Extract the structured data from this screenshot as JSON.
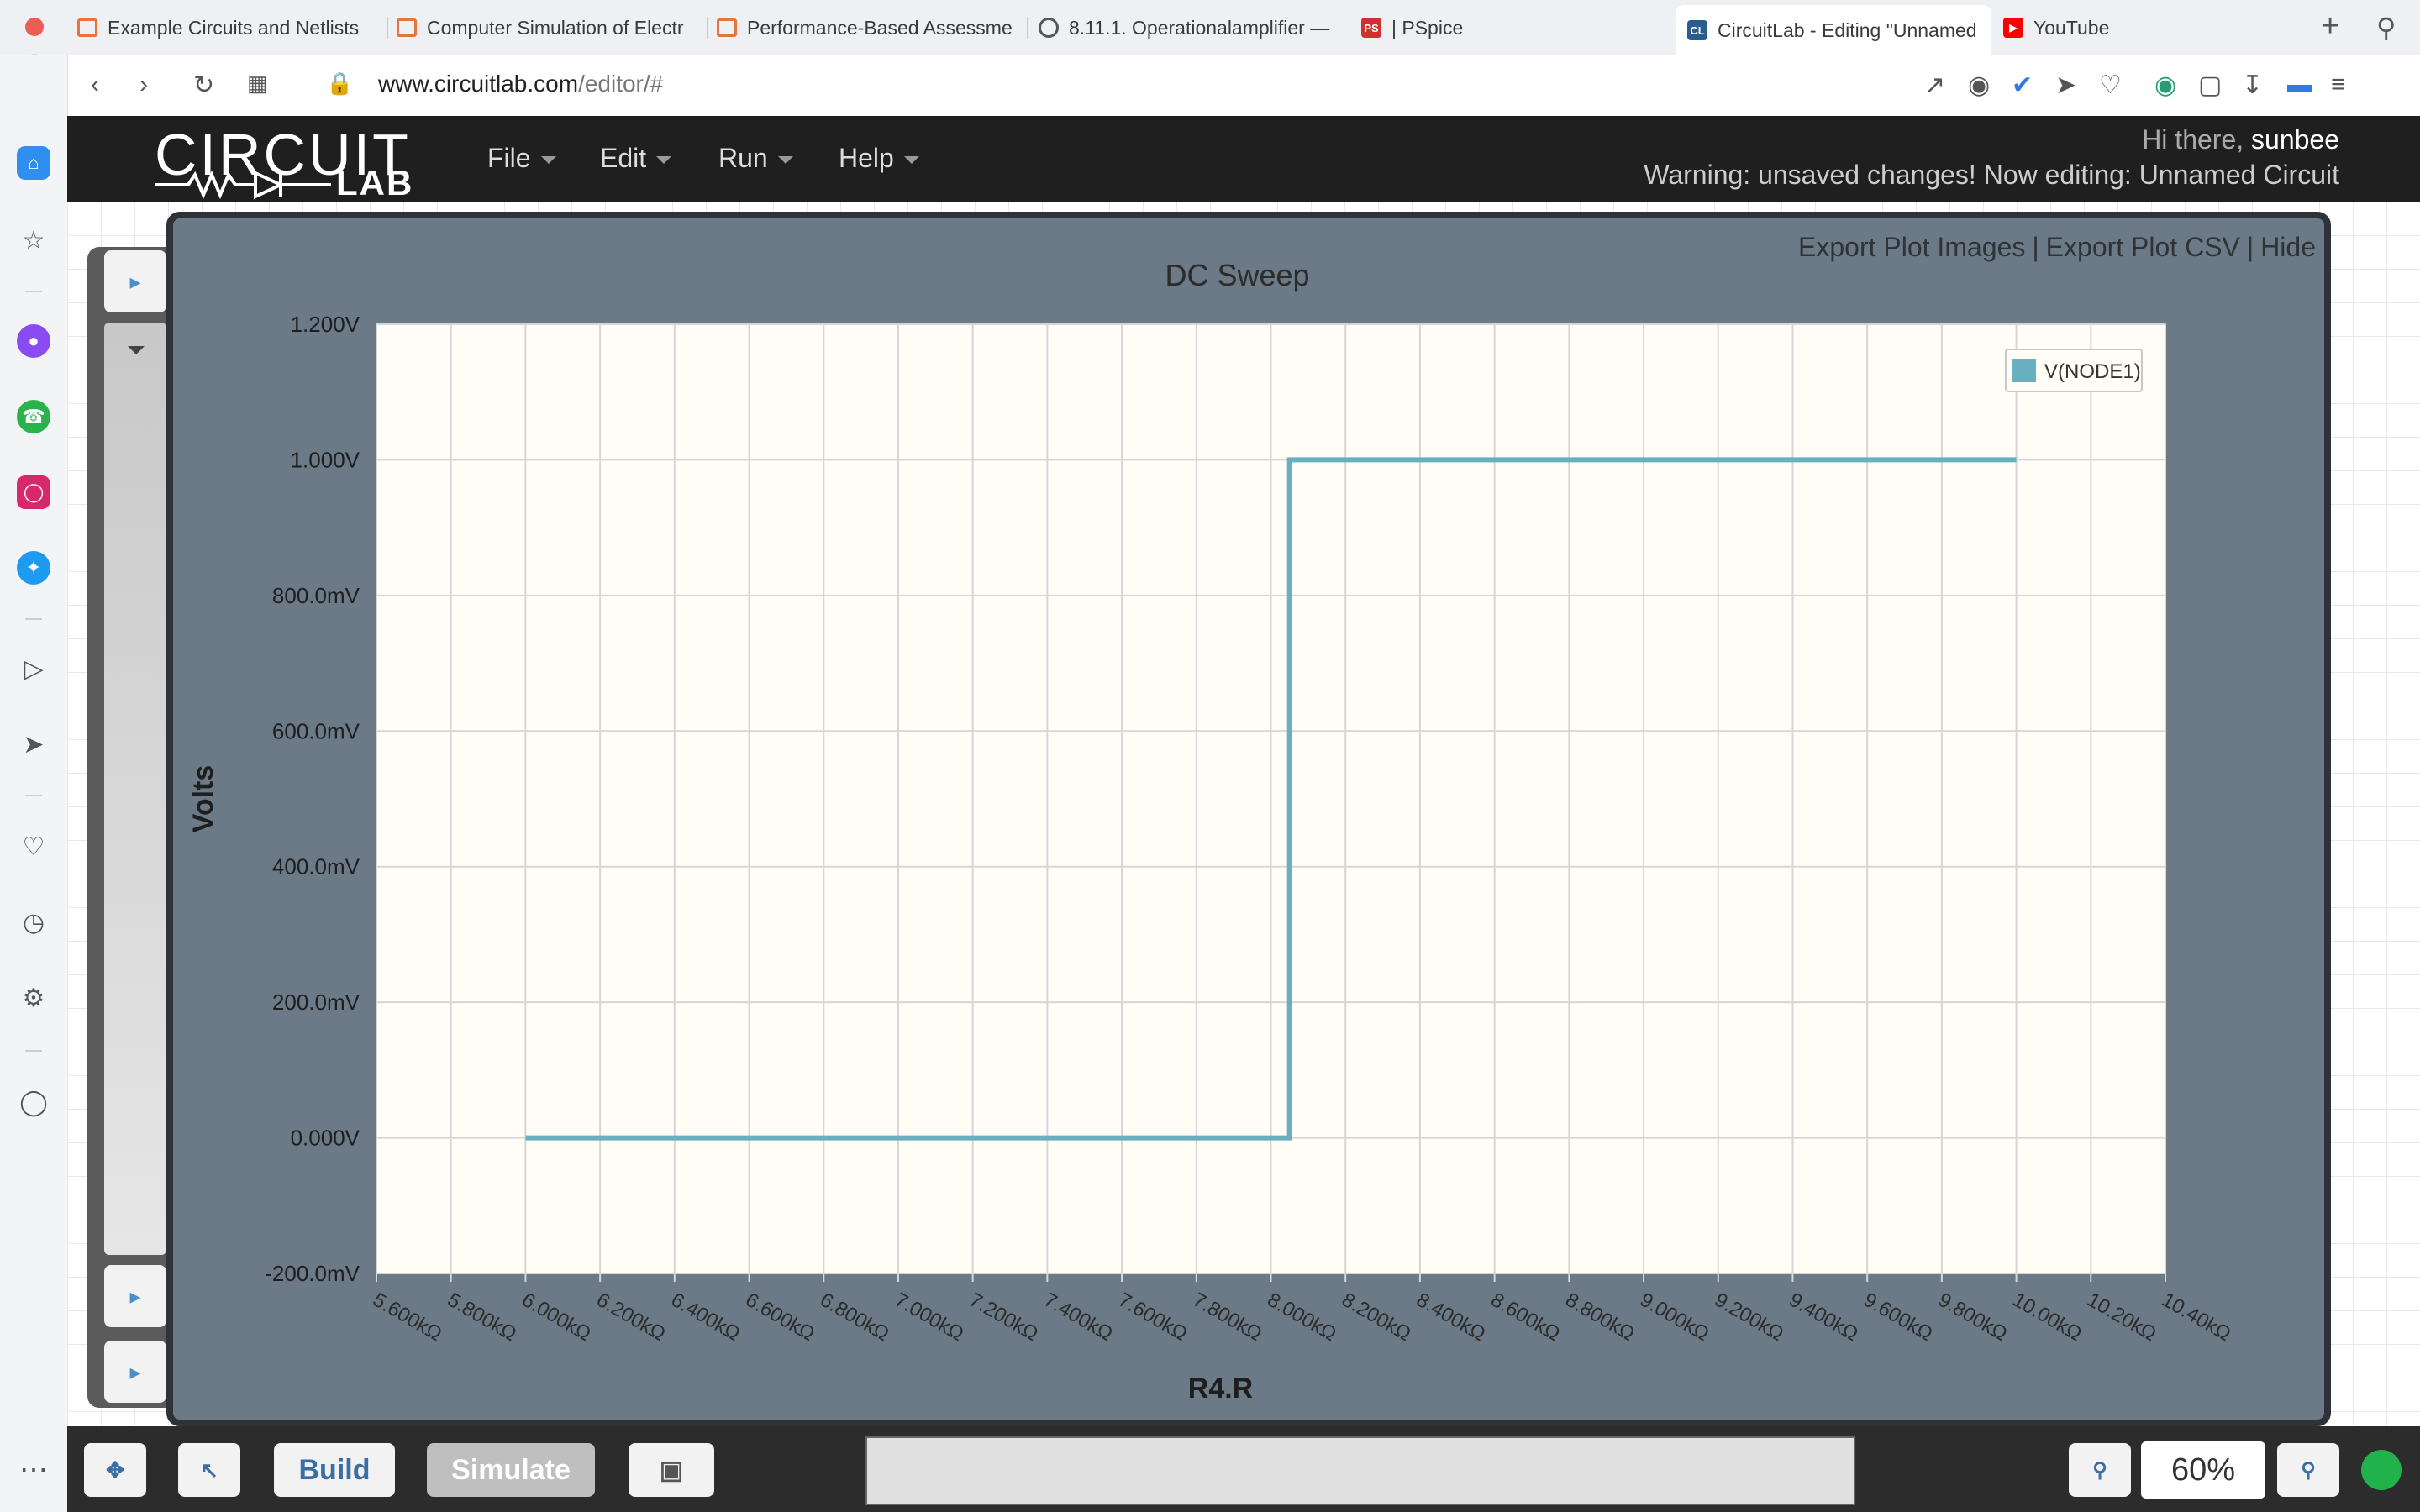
{
  "browser": {
    "tabs": [
      {
        "label": "Example Circuits and Netlists",
        "fav": "chip",
        "color": "#e8743b",
        "active": false
      },
      {
        "label": "Computer Simulation of Electr",
        "fav": "chip",
        "color": "#e8743b",
        "active": false
      },
      {
        "label": "Performance-Based Assessme",
        "fav": "chip",
        "color": "#e8743b",
        "active": false
      },
      {
        "label": "8.11.1. Operationalamplifier —",
        "fav": "globe",
        "color": "#555555",
        "active": false
      },
      {
        "label": "PSpice",
        "fav": "PS",
        "color": "#d0302f",
        "active": false
      },
      {
        "label": "CircuitLab - Editing \"Unnamed",
        "fav": "CL",
        "color": "#2a5d8f",
        "active": true
      },
      {
        "label": "YouTube",
        "fav": "yt",
        "color": "#ff0000",
        "active": false
      }
    ],
    "url_host": "www.circuitlab.com",
    "url_path": "/editor/#",
    "new_tab_icon": "plus-icon",
    "search_icon": "search-icon"
  },
  "app": {
    "logo_top": "CIRCUIT",
    "logo_bottom": "LAB",
    "menu": [
      "File",
      "Edit",
      "Run",
      "Help"
    ],
    "greeting": "Hi there,",
    "username": "sunbee",
    "warning": "Warning: unsaved changes! Now editing: Unnamed Circuit"
  },
  "plot_panel": {
    "links": [
      "Export Plot Images",
      "Export Plot CSV",
      "Hide"
    ]
  },
  "chart_data": {
    "type": "line",
    "title": "DC Sweep",
    "xlabel": "R4.R",
    "ylabel": "Volts",
    "legend": "top-right",
    "grid": true,
    "xlim": [
      5600,
      10400
    ],
    "ylim": [
      -0.2,
      1.2
    ],
    "x_ticks": [
      "5.600kΩ",
      "5.800kΩ",
      "6.000kΩ",
      "6.200kΩ",
      "6.400kΩ",
      "6.600kΩ",
      "6.800kΩ",
      "7.000kΩ",
      "7.200kΩ",
      "7.400kΩ",
      "7.600kΩ",
      "7.800kΩ",
      "8.000kΩ",
      "8.200kΩ",
      "8.400kΩ",
      "8.600kΩ",
      "8.800kΩ",
      "9.000kΩ",
      "9.200kΩ",
      "9.400kΩ",
      "9.600kΩ",
      "9.800kΩ",
      "10.00kΩ",
      "10.20kΩ",
      "10.40kΩ"
    ],
    "y_ticks": [
      "1.200V",
      "1.000V",
      "800.0mV",
      "600.0mV",
      "400.0mV",
      "200.0mV",
      "0.000V",
      "-200.0mV"
    ],
    "series": [
      {
        "name": "V(NODE1)",
        "color": "#6aafc0",
        "x": [
          6000,
          8050,
          8050,
          10000
        ],
        "y": [
          0.0,
          0.0,
          1.0,
          1.0
        ]
      }
    ]
  },
  "toolbar": {
    "move_icon": "move-icon",
    "select_icon": "pointer-icon",
    "build_label": "Build",
    "simulate_label": "Simulate",
    "image_icon": "image-icon",
    "zoom_out_icon": "zoom-out-icon",
    "zoom_level": "60%",
    "zoom_in_icon": "zoom-in-icon"
  },
  "sidebar_icons": [
    "home-icon",
    "star-icon",
    "messenger-icon",
    "whatsapp-icon",
    "instagram-icon",
    "twitter-icon",
    "player-icon",
    "send-icon",
    "heart-icon",
    "history-icon",
    "settings-icon",
    "bulb-icon",
    "more-icon"
  ]
}
